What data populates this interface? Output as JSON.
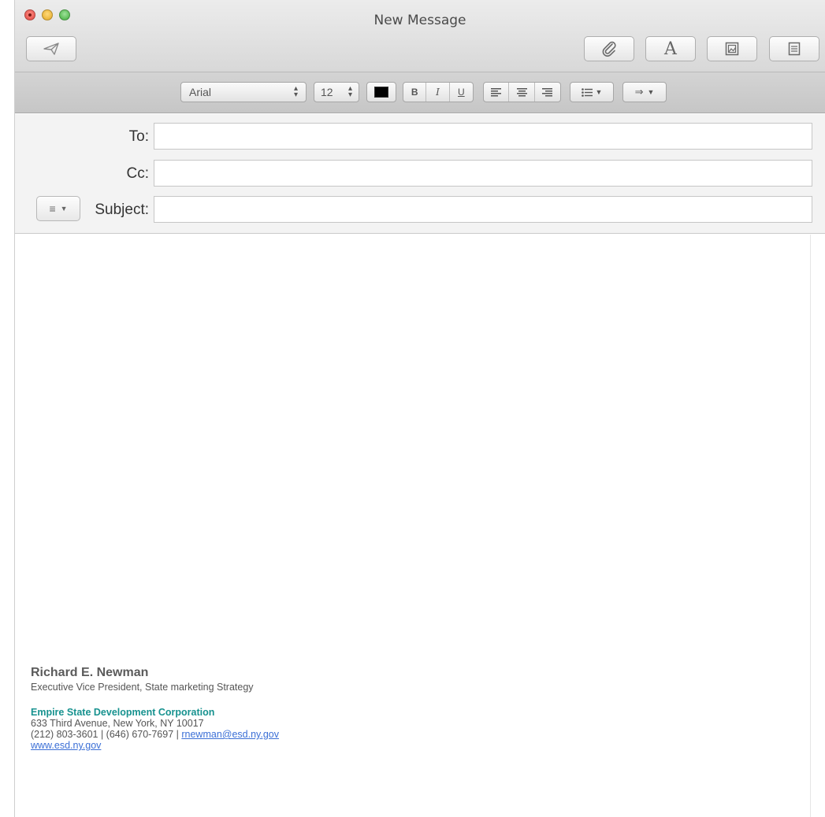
{
  "window": {
    "title": "New Message"
  },
  "format_bar": {
    "font_name": "Arial",
    "font_size": "12",
    "bold": "B",
    "italic": "I",
    "underline": "U",
    "text_color": "#000000"
  },
  "headers": {
    "to_label": "To:",
    "to_value": "",
    "cc_label": "Cc:",
    "cc_value": "",
    "subject_label": "Subject:",
    "subject_value": ""
  },
  "signature": {
    "name": "Richard E. Newman",
    "title": "Executive Vice President, State marketing Strategy",
    "organization": "Empire State Development Corporation",
    "address": "633 Third Avenue, New York, NY 10017",
    "phones": "(212) 803-3601 | (646) 670-7697 | ",
    "email": "rnewman@esd.ny.gov",
    "website": "www.esd.ny.gov"
  },
  "colors": {
    "org_accent": "#17928f",
    "link": "#3b6fd6"
  },
  "icons": [
    "close-light",
    "minimize-light",
    "zoom-light",
    "send-icon",
    "attachment-icon",
    "fonts-icon",
    "photo-browser-icon",
    "stationery-icon"
  ]
}
